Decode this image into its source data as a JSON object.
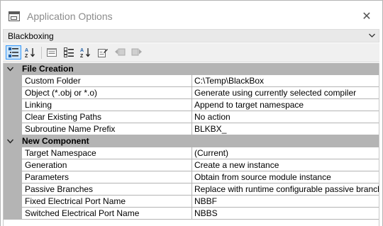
{
  "window": {
    "title": "Application Options",
    "close_glyph": "✕"
  },
  "selector": {
    "value": "Blackboxing"
  },
  "toolbar": {
    "buttons": [
      {
        "icon": "categorized-icon",
        "active": true
      },
      {
        "icon": "alphabetical-icon",
        "active": false
      },
      {
        "icon": "property-pages-icon",
        "active": false
      },
      {
        "icon": "categorized-alt-icon",
        "active": false
      },
      {
        "icon": "sort-az-icon",
        "active": false
      },
      {
        "icon": "edit-icon",
        "active": false
      },
      {
        "icon": "undo-icon",
        "active": false
      },
      {
        "icon": "redo-icon",
        "active": false
      }
    ]
  },
  "categories": [
    {
      "label": "File Creation",
      "properties": [
        {
          "name": "Custom Folder",
          "value": "C:\\Temp\\BlackBox"
        },
        {
          "name": "Object (*.obj or *.o)",
          "value": "Generate using currently selected compiler"
        },
        {
          "name": "Linking",
          "value": "Append to target namespace"
        },
        {
          "name": "Clear Existing Paths",
          "value": "No action"
        },
        {
          "name": "Subroutine Name Prefix",
          "value": "BLKBX_"
        }
      ]
    },
    {
      "label": "New Component",
      "properties": [
        {
          "name": "Target Namespace",
          "value": "(Current)"
        },
        {
          "name": "Generation",
          "value": "Create a new instance"
        },
        {
          "name": "Parameters",
          "value": "Obtain from source module instance"
        },
        {
          "name": "Passive Branches",
          "value": "Replace with runtime configurable passive branch"
        },
        {
          "name": "Fixed Electrical Port Name",
          "value": "NBBF"
        },
        {
          "name": "Switched Electrical Port Name",
          "value": "NBBS"
        }
      ]
    }
  ]
}
